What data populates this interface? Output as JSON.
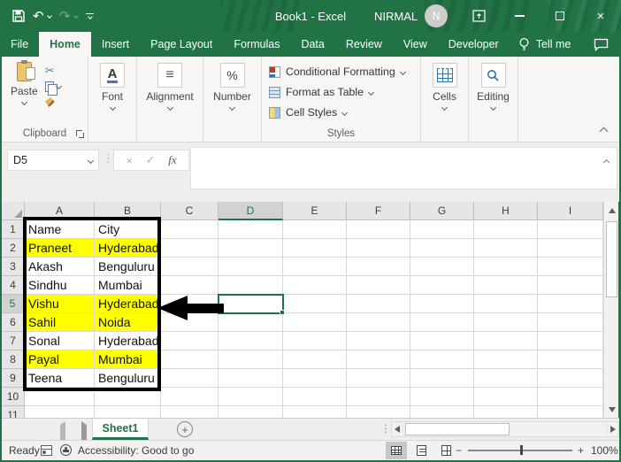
{
  "titlebar": {
    "title": "Book1 - Excel",
    "user_name": "NIRMAL",
    "avatar_initial": "N"
  },
  "tabs": {
    "items": [
      {
        "label": "File",
        "active": false
      },
      {
        "label": "Home",
        "active": true
      },
      {
        "label": "Insert",
        "active": false
      },
      {
        "label": "Page Layout",
        "active": false
      },
      {
        "label": "Formulas",
        "active": false
      },
      {
        "label": "Data",
        "active": false
      },
      {
        "label": "Review",
        "active": false
      },
      {
        "label": "View",
        "active": false
      },
      {
        "label": "Developer",
        "active": false
      }
    ],
    "tell_me": "Tell me"
  },
  "ribbon": {
    "paste_label": "Paste",
    "clipboard_group_label": "Clipboard",
    "font_group_label": "Font",
    "alignment_group_label": "Alignment",
    "number_group_label": "Number",
    "styles": {
      "conditional_formatting": "Conditional Formatting",
      "format_as_table": "Format as Table",
      "cell_styles": "Cell Styles",
      "group_label": "Styles"
    },
    "cells_group_label": "Cells",
    "editing_group_label": "Editing"
  },
  "formula_bar": {
    "name_box_value": "D5",
    "fx_label": "fx",
    "formula_value": ""
  },
  "grid": {
    "columns": [
      "A",
      "B",
      "C",
      "D",
      "E",
      "F",
      "G",
      "H",
      "I"
    ],
    "selected_column": "D",
    "selected_row": 5,
    "selected_cell": "D5",
    "visible_row_count": 11,
    "highlight_range": "A1:B9",
    "rows": [
      {
        "n": 1,
        "name": "Name",
        "city": "City",
        "highlighted": false
      },
      {
        "n": 2,
        "name": "Praneet",
        "city": "Hyderabad",
        "highlighted": true
      },
      {
        "n": 3,
        "name": "Akash",
        "city": "Benguluru",
        "highlighted": false
      },
      {
        "n": 4,
        "name": "Sindhu",
        "city": "Mumbai",
        "highlighted": false
      },
      {
        "n": 5,
        "name": "Vishu",
        "city": "Hyderabad",
        "highlighted": true
      },
      {
        "n": 6,
        "name": "Sahil",
        "city": "Noida",
        "highlighted": true
      },
      {
        "n": 7,
        "name": "Sonal",
        "city": "Hyderabad",
        "highlighted": false
      },
      {
        "n": 8,
        "name": "Payal",
        "city": "Mumbai",
        "highlighted": true
      },
      {
        "n": 9,
        "name": "Teena",
        "city": "Benguluru",
        "highlighted": false
      }
    ]
  },
  "sheet_bar": {
    "active_sheet": "Sheet1"
  },
  "status_bar": {
    "mode": "Ready",
    "accessibility": "Accessibility: Good to go",
    "zoom_level": "100%"
  },
  "icons": {
    "undo": "↶",
    "redo": "↷",
    "cut": "✂",
    "font_letter": "A",
    "alignment": "≡",
    "percent": "%",
    "cancel": "×",
    "enter": "✓",
    "name_box_arrow": "▾",
    "dots_vertical": "⋮",
    "close": "×",
    "plus": "+",
    "zoom_minus": "−",
    "zoom_plus": "+"
  },
  "colors": {
    "excel_green": "#217346",
    "highlight_yellow": "#FFFF00",
    "selection_border": "#1E7145",
    "annotation_arrow": "#000000"
  }
}
